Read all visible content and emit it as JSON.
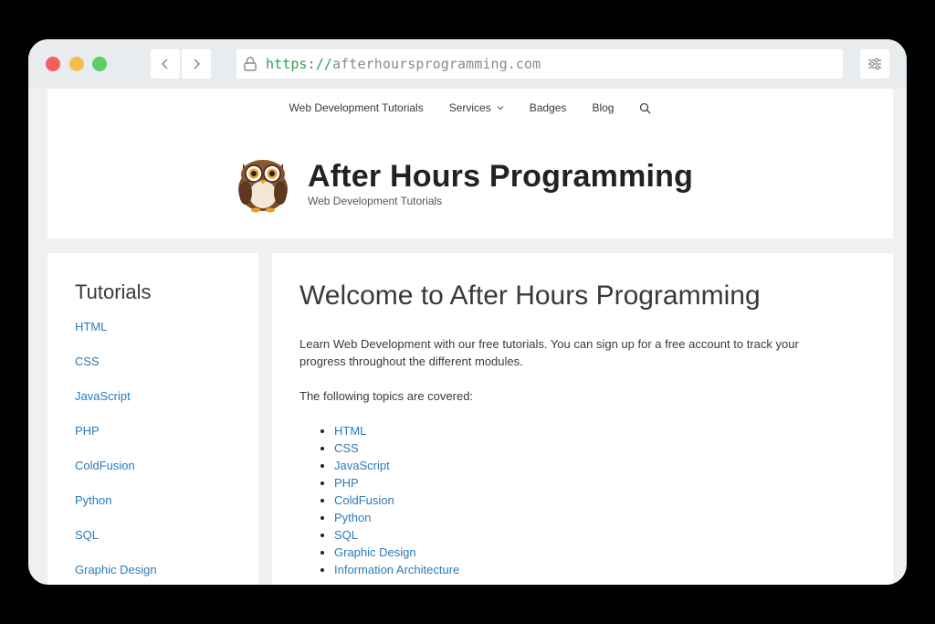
{
  "browser": {
    "url_protocol": "https://",
    "url_host": "afterhoursprogramming.com"
  },
  "nav": {
    "items": [
      {
        "label": "Web Development Tutorials"
      },
      {
        "label": "Services"
      },
      {
        "label": "Badges"
      },
      {
        "label": "Blog"
      }
    ]
  },
  "brand": {
    "title": "After Hours Programming",
    "tagline": "Web Development Tutorials"
  },
  "sidebar": {
    "title": "Tutorials",
    "items": [
      "HTML",
      "CSS",
      "JavaScript",
      "PHP",
      "ColdFusion",
      "Python",
      "SQL",
      "Graphic Design"
    ]
  },
  "main": {
    "heading": "Welcome to After Hours Programming",
    "intro": "Learn Web Development with our free tutorials. You can sign up for a free account to track your progress throughout the different modules.",
    "topics_intro": "The following topics are covered:",
    "topics": [
      "HTML",
      "CSS",
      "JavaScript",
      "PHP",
      "ColdFusion",
      "Python",
      "SQL",
      "Graphic Design",
      "Information Architecture"
    ]
  },
  "colors": {
    "link": "#2a7bb8",
    "close_dot": "#f2605b",
    "minimize_dot": "#f5bd4f",
    "maximize_dot": "#5ccd64"
  }
}
